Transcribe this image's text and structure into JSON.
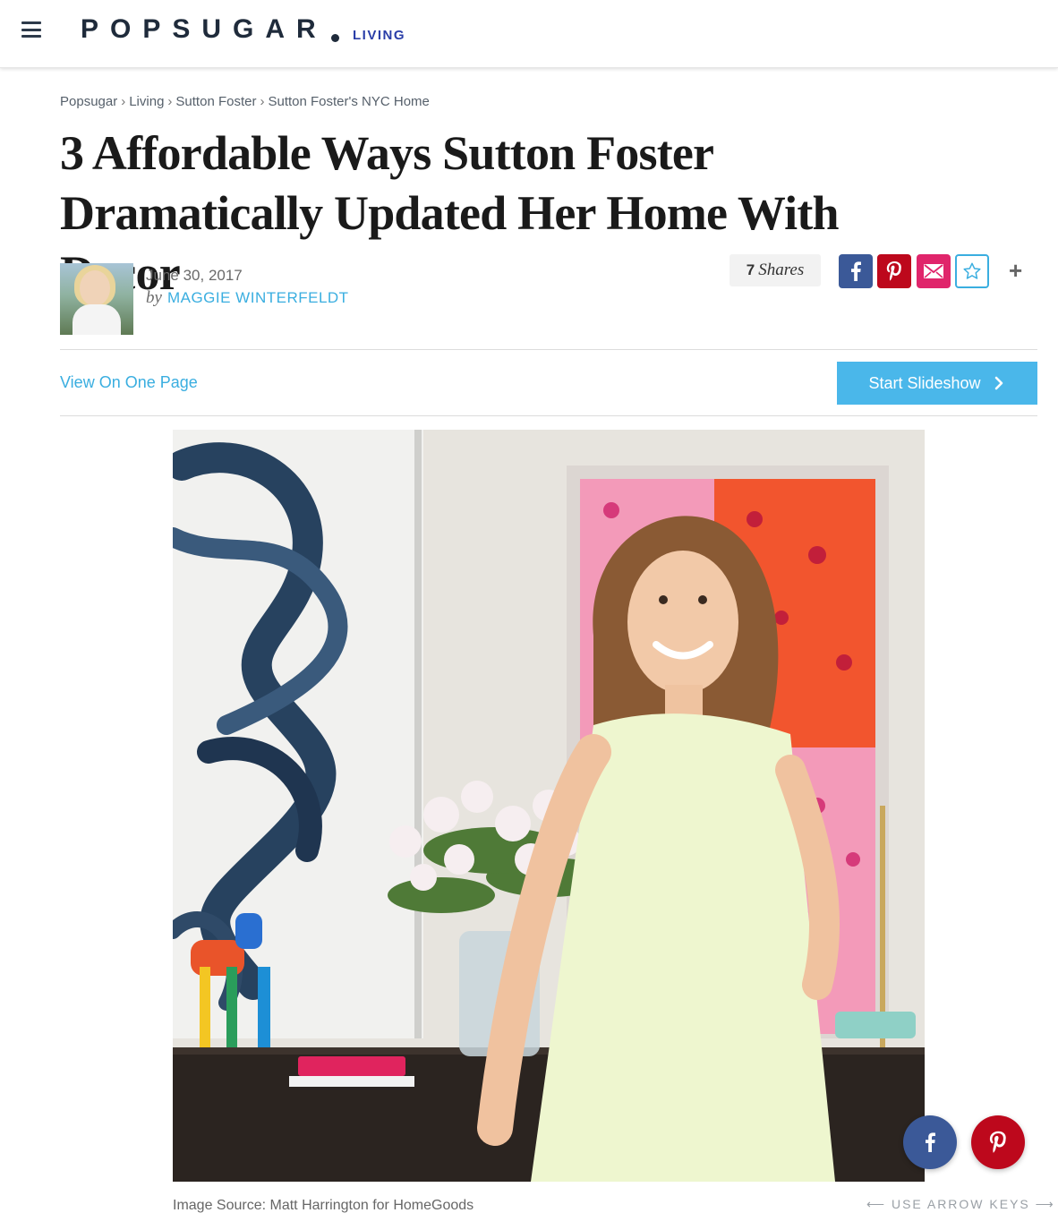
{
  "header": {
    "logo_text": "POPSUGAR",
    "section_label": "LIVING"
  },
  "breadcrumb": [
    {
      "label": "Popsugar"
    },
    {
      "label": "Living"
    },
    {
      "label": "Sutton Foster"
    },
    {
      "label": "Sutton Foster's NYC Home"
    }
  ],
  "breadcrumb_separator": "›",
  "article": {
    "title": "3 Affordable Ways Sutton Foster Dramatically Updated Her Home With Decor",
    "date": "June 30, 2017",
    "by_label": "by",
    "author": "MAGGIE WINTERFELDT"
  },
  "share": {
    "count": "7",
    "label": "Shares",
    "buttons": [
      "facebook-icon",
      "pinterest-icon",
      "email-icon",
      "star-icon"
    ],
    "more_label": "+"
  },
  "actions": {
    "view_one_page": "View On One Page",
    "start_slideshow": "Start Slideshow"
  },
  "image": {
    "caption": "Image Source: Matt Harrington for HomeGoods",
    "nav_hint": "⟵ USE ARROW KEYS ⟶"
  },
  "colors": {
    "facebook": "#3b5998",
    "pinterest": "#bd081c",
    "email": "#e0256b",
    "accent": "#3aaee0"
  }
}
